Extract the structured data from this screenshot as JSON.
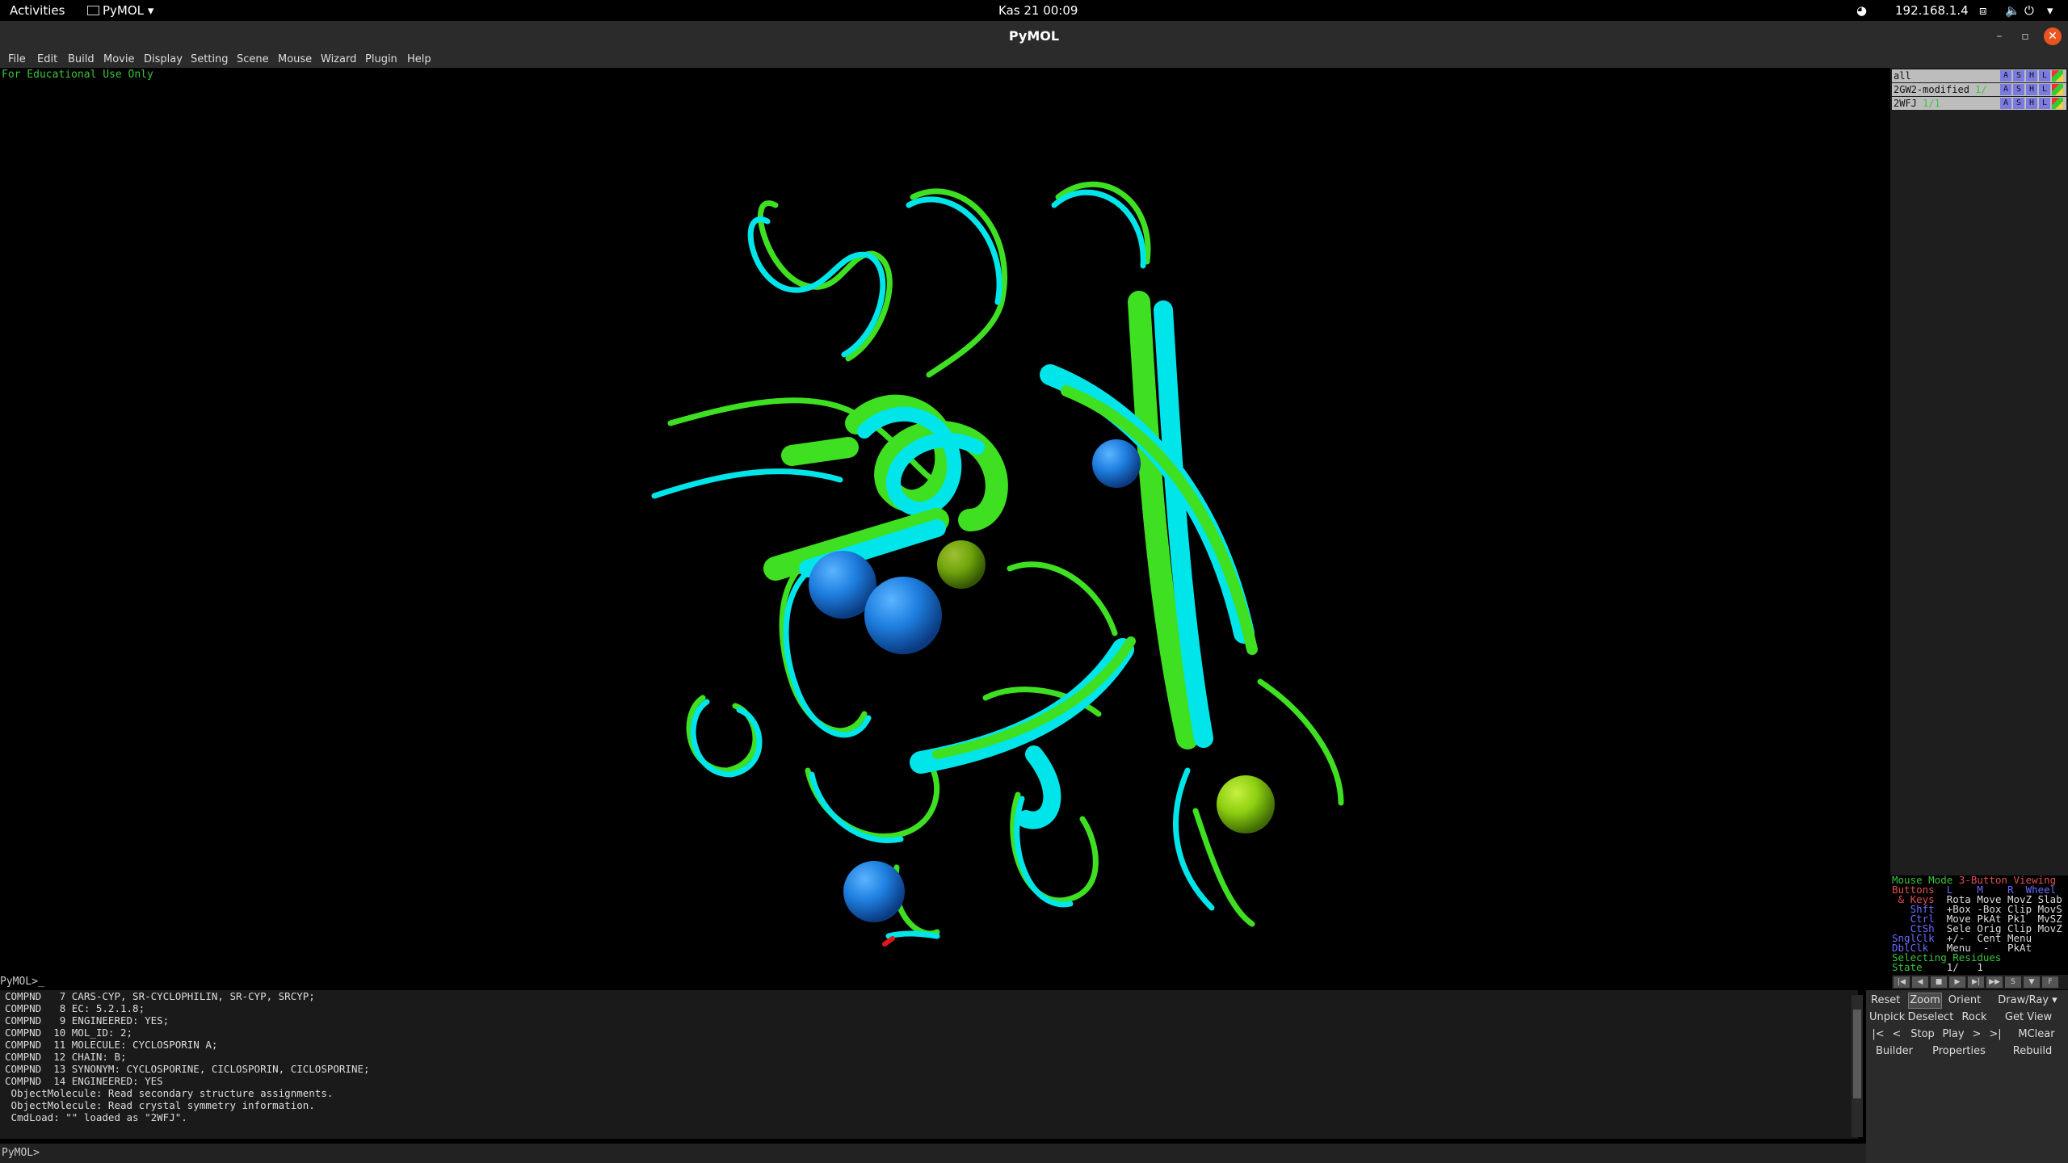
{
  "topbar": {
    "activities": "Activities",
    "app_name": "PyMOL",
    "clock": "Kas 21  00:09",
    "ip": "192.168.1.4"
  },
  "window": {
    "title": "PyMOL",
    "minimize": "–",
    "maximize": "▫",
    "close": "✕"
  },
  "menu": [
    "File",
    "Edit",
    "Build",
    "Movie",
    "Display",
    "Setting",
    "Scene",
    "Mouse",
    "Wizard",
    "Plugin",
    "Help"
  ],
  "viewer": {
    "edu_notice": "For Educational Use Only",
    "colors": {
      "model1": "#3fdf22",
      "model2": "#00e5ea",
      "sphere_blue": "#1f7fe0",
      "sphere_green": "#8ccf10",
      "oxygen": "#e01818"
    }
  },
  "objects": [
    {
      "name": "all",
      "state": ""
    },
    {
      "name": "2GW2-modified",
      "state": "1/"
    },
    {
      "name": "2WFJ",
      "state": "1/1"
    }
  ],
  "object_buttons": [
    "A",
    "S",
    "H",
    "L",
    ""
  ],
  "mouse_help": {
    "l1a": "Mouse Mode ",
    "l1b": "3-Button Viewing",
    "l2a": "Buttons  ",
    "l2b": "L    M    R  Wheel",
    "l3a": " & Keys  ",
    "l3b": "Rota Move MovZ Slab",
    "l4a": "   Shft  ",
    "l4b": "+Box -Box Clip MovS",
    "l5a": "   Ctrl  ",
    "l5b": "Move PkAt Pk1  MvSZ",
    "l6a": "   CtSh  ",
    "l6b": "Sele Orig Clip MovZ",
    "l7a": "SnglClk  ",
    "l7b": "+/-  Cent Menu",
    "l8a": "DblClk   ",
    "l8b": "Menu  -   PkAt",
    "l9": "Selecting Residues",
    "l10a": "State  ",
    "l10b": "  1/   1"
  },
  "movie_controls": [
    "|◀",
    "◀",
    "■",
    "▶",
    "▶|",
    "▶▶",
    "S",
    "▼",
    "F"
  ],
  "command_prompt": "PyMOL>_",
  "output_lines": [
    "COMPND   7 CARS-CYP, SR-CYCLOPHILIN, SR-CYP, SRCYP;",
    "COMPND   8 EC: 5.2.1.8;",
    "COMPND   9 ENGINEERED: YES;",
    "COMPND  10 MOL_ID: 2;",
    "COMPND  11 MOLECULE: CYCLOSPORIN A;",
    "COMPND  12 CHAIN: B;",
    "COMPND  13 SYNONYM: CYCLOSPORINE, CICLOSPORIN, CICLOSPORINE;",
    "COMPND  14 ENGINEERED: YES",
    " ObjectMolecule: Read secondary structure assignments.",
    " ObjectMolecule: Read crystal symmetry information.",
    " CmdLoad: \"\" loaded as \"2WFJ\"."
  ],
  "bottom_prompt": "PyMOL>",
  "command_input_value": "",
  "buttons": {
    "reset": "Reset",
    "zoom": "Zoom",
    "orient": "Orient",
    "drawray": "Draw/Ray",
    "unpick": "Unpick",
    "deselect": "Deselect",
    "rock": "Rock",
    "getview": "Get View",
    "first": "|<",
    "prev": "<",
    "stop": "Stop",
    "play": "Play",
    "next": ">",
    "last": ">|",
    "mclear": "MClear",
    "builder": "Builder",
    "properties": "Properties",
    "rebuild": "Rebuild"
  }
}
